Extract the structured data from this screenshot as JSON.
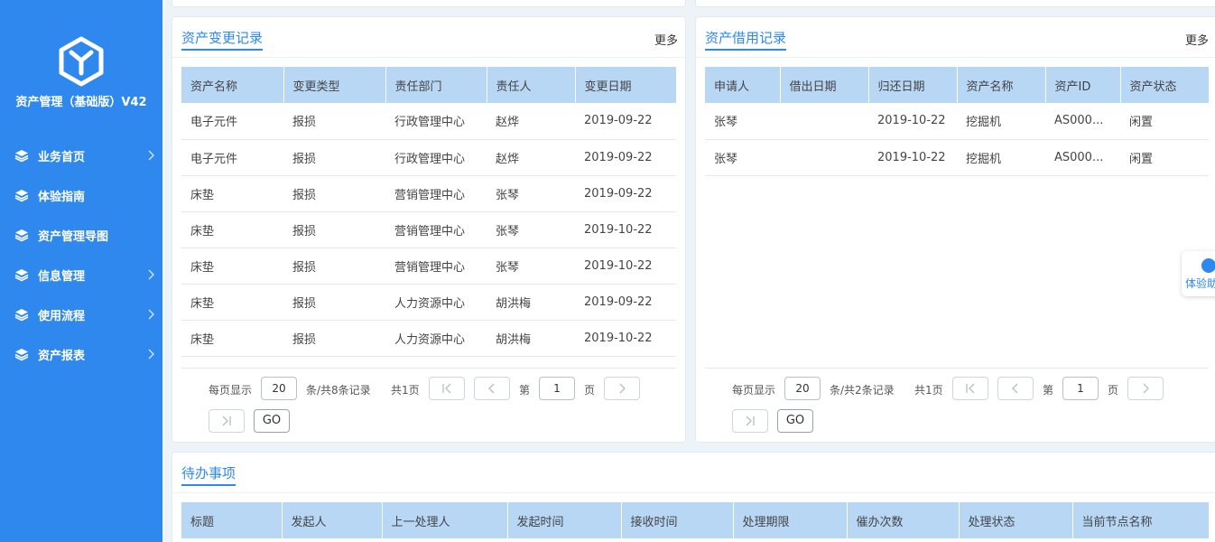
{
  "app": {
    "title": "资产管理（基础版）V42"
  },
  "colors": {
    "sidebar": "#2f88ee",
    "accent": "#2f88ee",
    "table_header": "#b8d7f5"
  },
  "sidebar": {
    "items": [
      {
        "label": "业务首页",
        "has_children": true
      },
      {
        "label": "体验指南",
        "has_children": false
      },
      {
        "label": "资产管理导图",
        "has_children": false
      },
      {
        "label": "信息管理",
        "has_children": true
      },
      {
        "label": "使用流程",
        "has_children": true
      },
      {
        "label": "资产报表",
        "has_children": true
      }
    ]
  },
  "changes": {
    "title": "资产变更记录",
    "more": "更多",
    "columns": [
      "资产名称",
      "变更类型",
      "责任部门",
      "责任人",
      "变更日期"
    ],
    "rows": [
      [
        "电子元件",
        "报损",
        "行政管理中心",
        "赵烨",
        "2019-09-22"
      ],
      [
        "电子元件",
        "报损",
        "行政管理中心",
        "赵烨",
        "2019-09-22"
      ],
      [
        "床垫",
        "报损",
        "营销管理中心",
        "张琴",
        "2019-09-22"
      ],
      [
        "床垫",
        "报损",
        "营销管理中心",
        "张琴",
        "2019-10-22"
      ],
      [
        "床垫",
        "报损",
        "营销管理中心",
        "张琴",
        "2019-10-22"
      ],
      [
        "床垫",
        "报损",
        "人力资源中心",
        "胡洪梅",
        "2019-09-22"
      ],
      [
        "床垫",
        "报损",
        "人力资源中心",
        "胡洪梅",
        "2019-10-22"
      ]
    ],
    "pager": {
      "per_page_label": "每页显示",
      "per_page": "20",
      "total_label": "条/共8条记录",
      "pages_label": "共1页",
      "page_prefix": "第",
      "page": "1",
      "page_suffix": "页",
      "go": "GO"
    }
  },
  "borrow": {
    "title": "资产借用记录",
    "more": "更多",
    "columns": [
      "申请人",
      "借出日期",
      "归还日期",
      "资产名称",
      "资产ID",
      "资产状态"
    ],
    "rows": [
      [
        "张琴",
        "",
        "2019-10-22",
        "挖掘机",
        "AS000...",
        "闲置"
      ],
      [
        "张琴",
        "",
        "2019-10-22",
        "挖掘机",
        "AS000...",
        "闲置"
      ]
    ],
    "pager": {
      "per_page_label": "每页显示",
      "per_page": "20",
      "total_label": "条/共2条记录",
      "pages_label": "共1页",
      "page_prefix": "第",
      "page": "1",
      "page_suffix": "页",
      "go": "GO"
    }
  },
  "todo": {
    "title": "待办事项",
    "columns": [
      "标题",
      "发起人",
      "上一处理人",
      "发起时间",
      "接收时间",
      "处理期限",
      "催办次数",
      "处理状态",
      "当前节点名称"
    ]
  },
  "helper": {
    "label": "体验助"
  }
}
